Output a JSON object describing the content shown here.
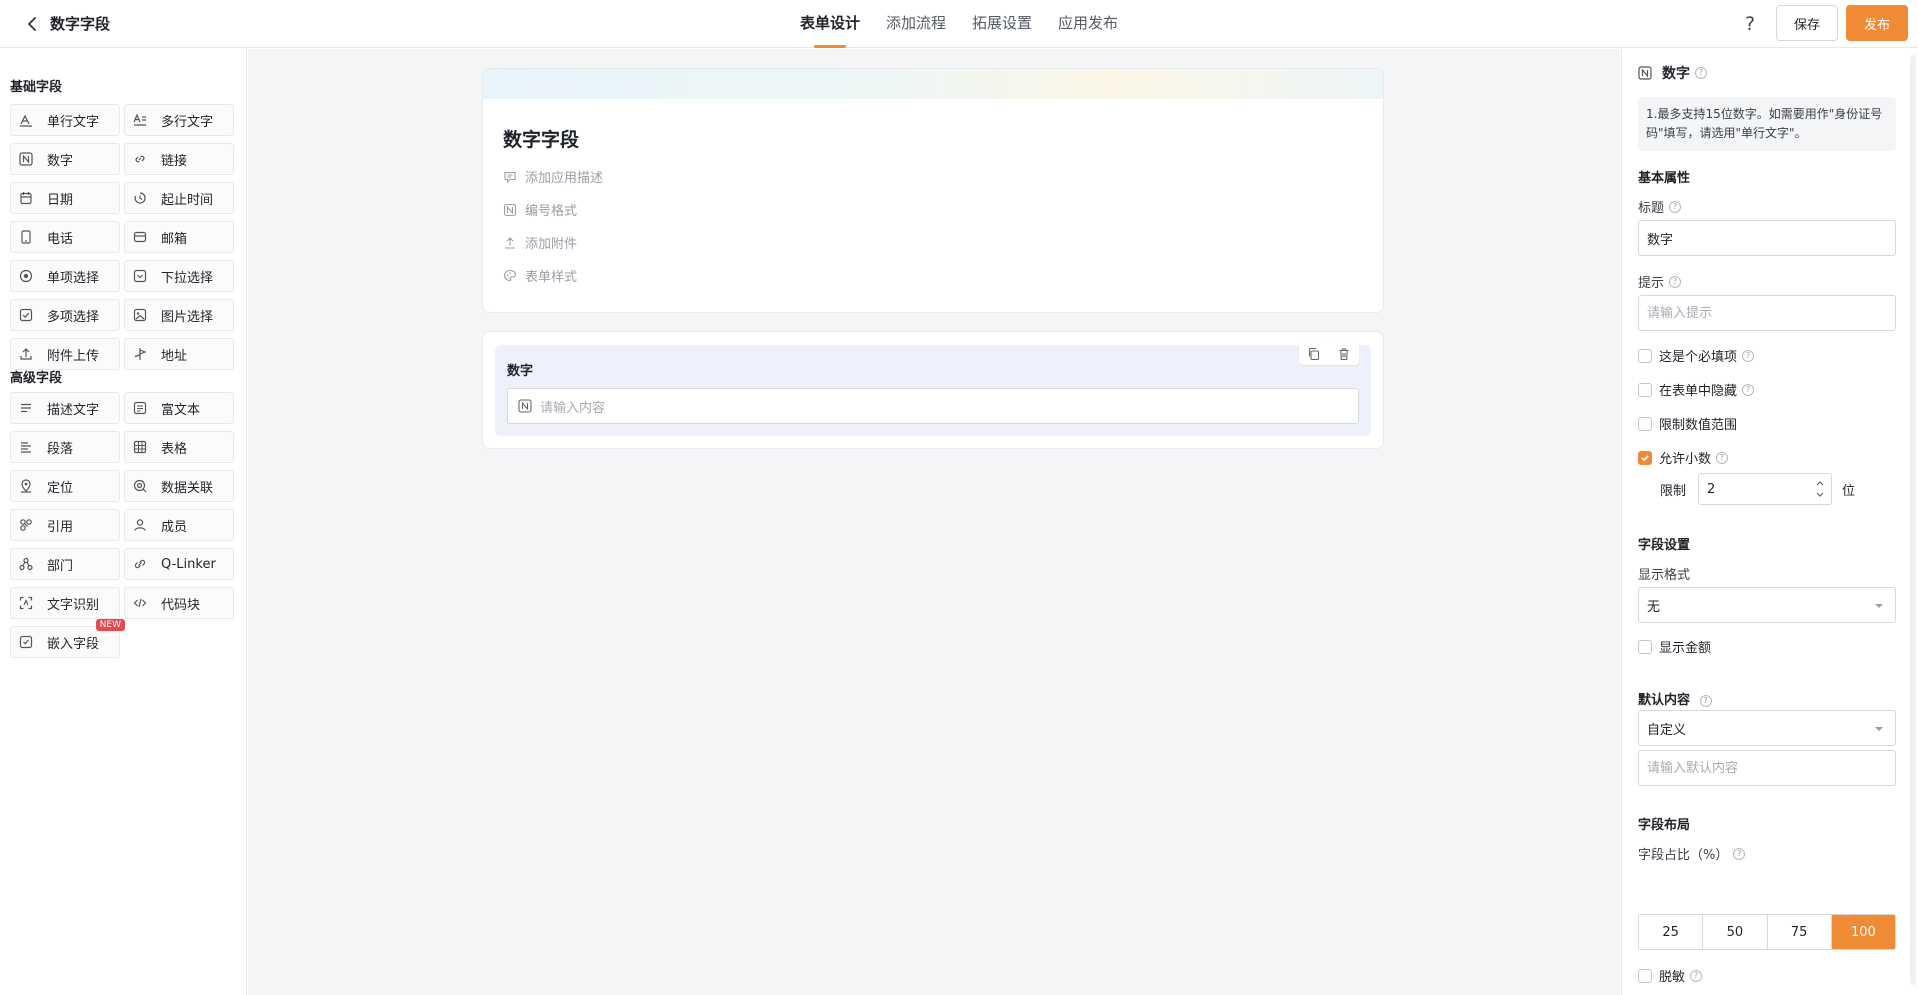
{
  "header": {
    "title": "数字字段",
    "tabs": [
      {
        "label": "表单设计",
        "active": true
      },
      {
        "label": "添加流程",
        "active": false
      },
      {
        "label": "拓展设置",
        "active": false
      },
      {
        "label": "应用发布",
        "active": false
      }
    ],
    "help_label": "?",
    "save_label": "保存",
    "publish_label": "发布"
  },
  "sidebar": {
    "basic_title": "基础字段",
    "basic_fields": [
      {
        "label": "单行文字",
        "icon": "single-line-text-icon"
      },
      {
        "label": "多行文字",
        "icon": "multi-line-text-icon"
      },
      {
        "label": "数字",
        "icon": "number-icon"
      },
      {
        "label": "链接",
        "icon": "link-icon"
      },
      {
        "label": "日期",
        "icon": "calendar-icon"
      },
      {
        "label": "起止时间",
        "icon": "time-range-icon"
      },
      {
        "label": "电话",
        "icon": "phone-icon"
      },
      {
        "label": "邮箱",
        "icon": "mail-icon"
      },
      {
        "label": "单项选择",
        "icon": "radio-icon"
      },
      {
        "label": "下拉选择",
        "icon": "dropdown-icon"
      },
      {
        "label": "多项选择",
        "icon": "checkbox-icon"
      },
      {
        "label": "图片选择",
        "icon": "image-icon"
      },
      {
        "label": "附件上传",
        "icon": "upload-icon"
      },
      {
        "label": "地址",
        "icon": "address-icon"
      }
    ],
    "advanced_title": "高级字段",
    "advanced_fields": [
      {
        "label": "描述文字",
        "icon": "description-icon"
      },
      {
        "label": "富文本",
        "icon": "rich-text-icon"
      },
      {
        "label": "段落",
        "icon": "paragraph-icon"
      },
      {
        "label": "表格",
        "icon": "table-icon"
      },
      {
        "label": "定位",
        "icon": "location-icon"
      },
      {
        "label": "数据关联",
        "icon": "data-link-icon"
      },
      {
        "label": "引用",
        "icon": "reference-icon"
      },
      {
        "label": "成员",
        "icon": "member-icon"
      },
      {
        "label": "部门",
        "icon": "department-icon"
      },
      {
        "label": "Q-Linker",
        "icon": "q-linker-icon"
      },
      {
        "label": "文字识别",
        "icon": "ocr-icon"
      },
      {
        "label": "代码块",
        "icon": "code-icon"
      },
      {
        "label": "嵌入字段",
        "icon": "embed-icon",
        "badge": "NEW"
      }
    ]
  },
  "form": {
    "title": "数字字段",
    "meta": [
      {
        "label": "添加应用描述",
        "icon": "description-icon"
      },
      {
        "label": "编号格式",
        "icon": "number-format-icon"
      },
      {
        "label": "添加附件",
        "icon": "attachment-icon"
      },
      {
        "label": "表单样式",
        "icon": "palette-icon"
      }
    ],
    "field": {
      "label": "数字",
      "placeholder": "请输入内容"
    }
  },
  "props": {
    "header": "数字",
    "note": "1.最多支持15位数字。如需要用作\"身份证号码\"填写，请选用\"单行文字\"。",
    "basic_section": "基本属性",
    "title_label": "标题",
    "title_value": "数字",
    "hint_label": "提示",
    "hint_placeholder": "请输入提示",
    "checks": [
      {
        "label": "这是个必填项",
        "checked": false,
        "help": true
      },
      {
        "label": "在表单中隐藏",
        "checked": false,
        "help": true
      },
      {
        "label": "限制数值范围",
        "checked": false,
        "help": false
      },
      {
        "label": "允许小数",
        "checked": true,
        "help": true
      }
    ],
    "limit_label": "限制",
    "limit_value": "2",
    "limit_unit": "位",
    "field_section": "字段设置",
    "display_format_label": "显示格式",
    "display_format_value": "无",
    "show_amount_label": "显示金额",
    "default_section": "默认内容",
    "default_type_value": "自定义",
    "default_placeholder": "请输入默认内容",
    "layout_section": "字段布局",
    "ratio_label": "字段占比（%）",
    "ratio_options": [
      "25",
      "50",
      "75",
      "100"
    ],
    "ratio_selected": "100",
    "desensitize_label": "脱敏"
  },
  "colors": {
    "accent": "#ef8a35",
    "badge": "#e5484d"
  }
}
